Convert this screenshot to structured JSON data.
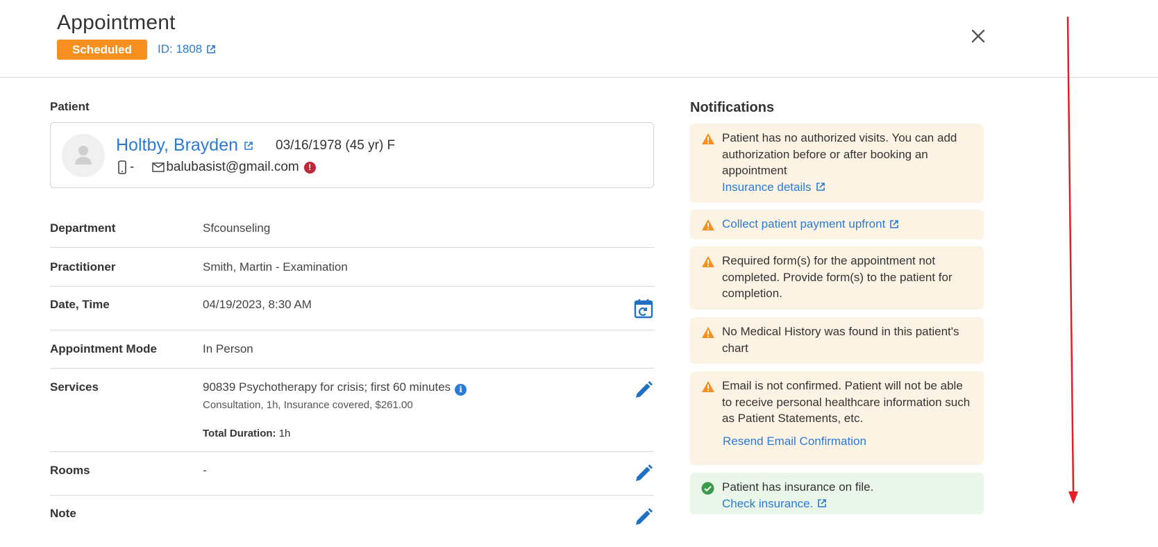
{
  "header": {
    "title": "Appointment",
    "status_badge": "Scheduled",
    "id_link": "ID: 1808"
  },
  "patient": {
    "section_label": "Patient",
    "name": "Holtby, Brayden",
    "dob": "03/16/1978 (45 yr) F",
    "phone": "-",
    "email": "balubasist@gmail.com"
  },
  "details": {
    "department": {
      "label": "Department",
      "value": "Sfcounseling"
    },
    "practitioner": {
      "label": "Practitioner",
      "value": "Smith, Martin - Examination"
    },
    "datetime": {
      "label": "Date, Time",
      "value": "04/19/2023, 8:30 AM"
    },
    "mode": {
      "label": "Appointment Mode",
      "value": "In Person"
    },
    "services": {
      "label": "Services",
      "value": "90839 Psychotherapy for crisis; first 60 minutes",
      "sub": "Consultation, 1h, Insurance covered, $261.00",
      "total_label": "Total Duration:",
      "total_value": "1h"
    },
    "rooms": {
      "label": "Rooms",
      "value": "-"
    },
    "note": {
      "label": "Note"
    }
  },
  "notifications": {
    "title": "Notifications",
    "items": [
      {
        "text": "Patient has no authorized visits. You can add authorization before or after booking an appointment",
        "link": "Insurance details"
      },
      {
        "link": "Collect patient payment upfront"
      },
      {
        "text": "Required form(s) for the appointment not completed. Provide form(s) to the patient for completion."
      },
      {
        "text": "No Medical History was found in this patient's chart"
      },
      {
        "text": "Email is not confirmed. Patient will not be able to receive personal healthcare information such as Patient Statements, etc.",
        "link": "Resend Email Confirmation"
      },
      {
        "text": "Patient has insurance on file.",
        "link": "Check insurance."
      }
    ]
  },
  "colors": {
    "accent": "#2b7bd6",
    "badge": "#f7901e",
    "warning_bg": "#fdf3e4",
    "success_bg": "#e9f6e9",
    "error": "#c0283a"
  },
  "icons": [
    "external-link-icon",
    "close-icon",
    "avatar-placeholder-icon",
    "phone-icon",
    "mail-icon",
    "error-icon",
    "calendar-refresh-icon",
    "pencil-icon",
    "info-icon",
    "warning-triangle-icon",
    "check-circle-icon"
  ]
}
